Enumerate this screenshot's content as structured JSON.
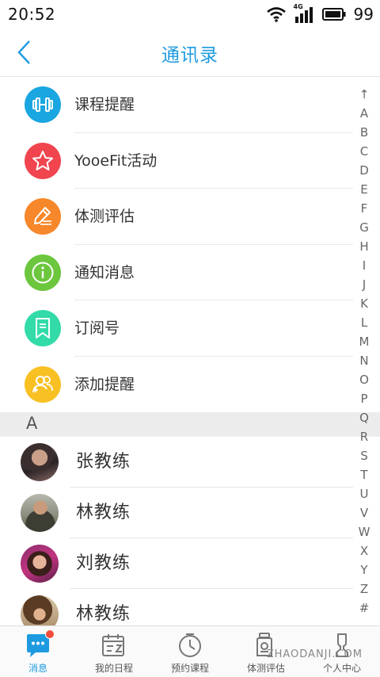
{
  "status_bar": {
    "time": "20:52",
    "network": "4G",
    "battery": "99"
  },
  "header": {
    "title": "通讯录"
  },
  "fixed_items": [
    {
      "label": "课程提醒",
      "icon": "dumbbell-icon",
      "color": "#1aa6e0"
    },
    {
      "label": "YooeFit活动",
      "icon": "star-icon",
      "color": "#f0454f"
    },
    {
      "label": "体测评估",
      "icon": "pencil-note-icon",
      "color": "#f7872b"
    },
    {
      "label": "通知消息",
      "icon": "info-icon",
      "color": "#6cc63e"
    },
    {
      "label": "订阅号",
      "icon": "bookmark-icon",
      "color": "#33dba8"
    },
    {
      "label": "添加提醒",
      "icon": "add-contact-icon",
      "color": "#f8c023"
    }
  ],
  "section_header": "A",
  "contacts": [
    {
      "name": "张教练"
    },
    {
      "name": "林教练"
    },
    {
      "name": "刘教练"
    },
    {
      "name": "林教练"
    }
  ],
  "index_letters": [
    "↑",
    "A",
    "B",
    "C",
    "D",
    "E",
    "F",
    "G",
    "H",
    "I",
    "J",
    "K",
    "L",
    "M",
    "N",
    "O",
    "P",
    "Q",
    "R",
    "S",
    "T",
    "U",
    "V",
    "W",
    "X",
    "Y",
    "Z",
    "#"
  ],
  "tabs": [
    {
      "label": "消息",
      "icon": "message-icon",
      "active": true
    },
    {
      "label": "我的日程",
      "icon": "calendar-icon",
      "active": false
    },
    {
      "label": "预约课程",
      "icon": "clock-icon",
      "active": false
    },
    {
      "label": "体测评估",
      "icon": "scale-icon",
      "active": false
    },
    {
      "label": "个人中心",
      "icon": "person-icon",
      "active": false
    }
  ],
  "watermark": "ZHAODANJI.COM",
  "colors": {
    "accent": "#1e9be0",
    "badge": "#f24b3c"
  }
}
